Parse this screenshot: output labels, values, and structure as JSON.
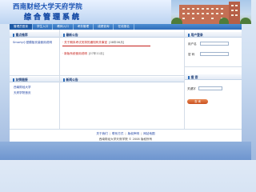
{
  "header": {
    "school_name": "西南财经大学天府学院",
    "system_name": "综合管理系统"
  },
  "nav": {
    "items": [
      {
        "label": "管理员登录",
        "active": true
      },
      {
        "label": "学生入口",
        "active": false
      },
      {
        "label": "教师入口",
        "active": false
      },
      {
        "label": "考务管理",
        "active": false
      },
      {
        "label": "成绩查询",
        "active": false
      },
      {
        "label": "在线报名",
        "active": false
      }
    ]
  },
  "left_top": {
    "title": "重点推荐",
    "links": [
      "Smarty小型模板安装使用说明"
    ]
  },
  "notices": {
    "title": "最新公告",
    "rows": [
      {
        "title": "关于期末考试安排的通知有关事宜",
        "date": "[08年06月]"
      },
      {
        "title": "新版系统使用说明",
        "date": "[07年11月]"
      }
    ]
  },
  "left_bottom": {
    "title": "友情链接",
    "links": [
      "西南财经大学",
      "天府学院首页"
    ]
  },
  "news": {
    "title": "新闻公告"
  },
  "login": {
    "title": "用户登录",
    "user_label": "用户名",
    "pass_label": "密 码",
    "button_label": "登录"
  },
  "search": {
    "title": "搜 索",
    "keyword_label": "关键字",
    "button_label": "查 询"
  },
  "footer": {
    "links": [
      "关于我们",
      "联系方式",
      "版权声明",
      "网站地图"
    ],
    "copyright": "西南财经大学天府学院 © 2008 版权所有"
  },
  "colors": {
    "accent": "#2d6cb8",
    "notice_red": "#c4201a",
    "button_orange": "#d9672f"
  }
}
